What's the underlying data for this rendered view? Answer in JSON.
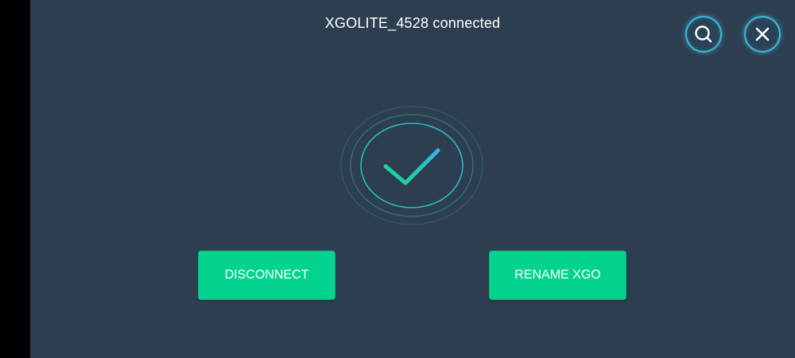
{
  "header": {
    "title": "XGOLITE_4528 connected",
    "search_icon": "search-icon",
    "close_icon": "close-icon"
  },
  "status": {
    "icon": "check-icon",
    "state": "connected"
  },
  "actions": {
    "disconnect_label": "DISCONNECT",
    "rename_label": "RENAME XGO"
  },
  "colors": {
    "background": "#2d3e50",
    "accent_green": "#03d38f",
    "accent_blue": "#3fb4d8",
    "text": "#ffffff"
  }
}
